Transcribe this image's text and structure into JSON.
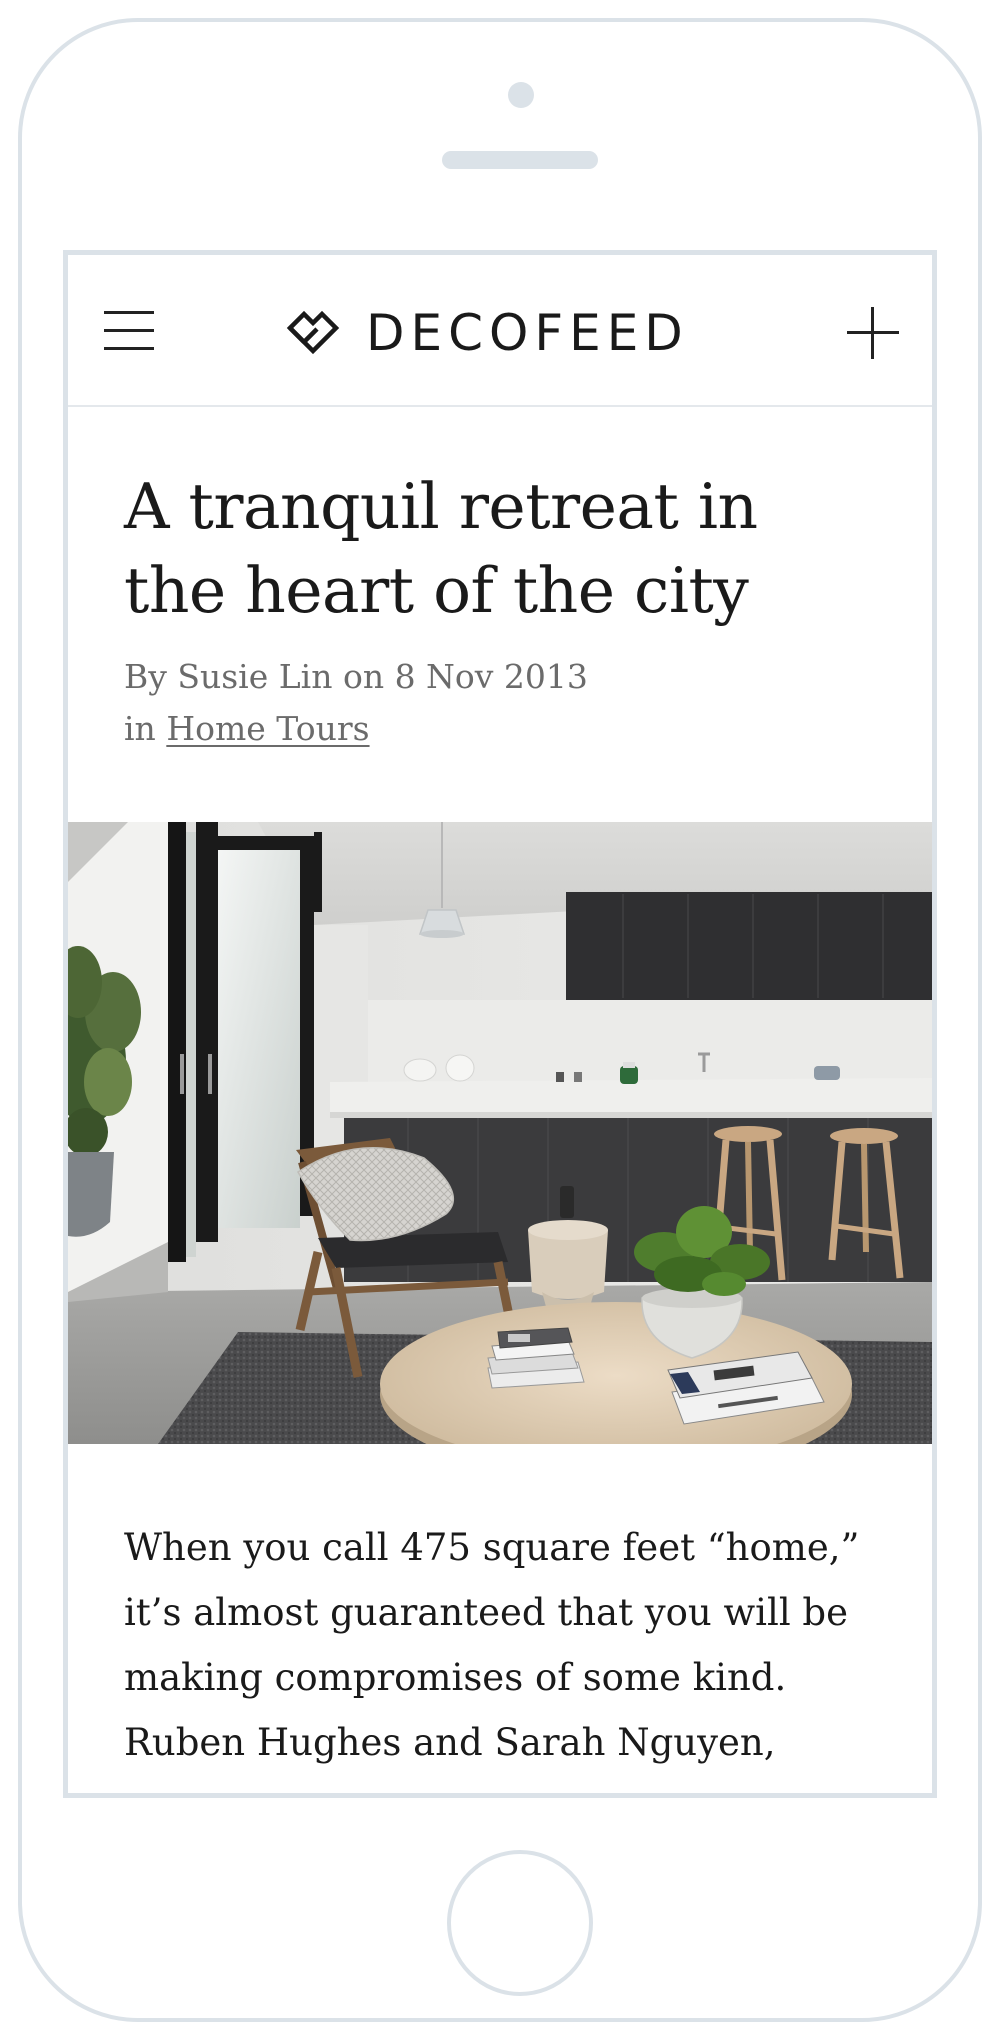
{
  "app": {
    "brand": "DECOFEED",
    "icons": {
      "menu": "hamburger-menu-icon",
      "logo": "heart-diamond-logo-icon",
      "add": "plus-icon"
    }
  },
  "article": {
    "title_line1": "A tranquil retreat in",
    "title_line2": "the heart of the city",
    "byline": "By Susie Lin on 8 Nov 2013",
    "category_prefix": "in ",
    "category_link": "Home Tours",
    "body_line1": "When you call 475 square feet “home,”",
    "body_line2": "it’s almost guaranteed that you will be",
    "body_line3": "making compromises of some kind.",
    "body_line4": "Ruben Hughes and Sarah Nguyen,"
  },
  "colors": {
    "device_frame": "#dbe2e8",
    "text_primary": "#1a1a1a",
    "text_muted": "#6b6b6b"
  }
}
